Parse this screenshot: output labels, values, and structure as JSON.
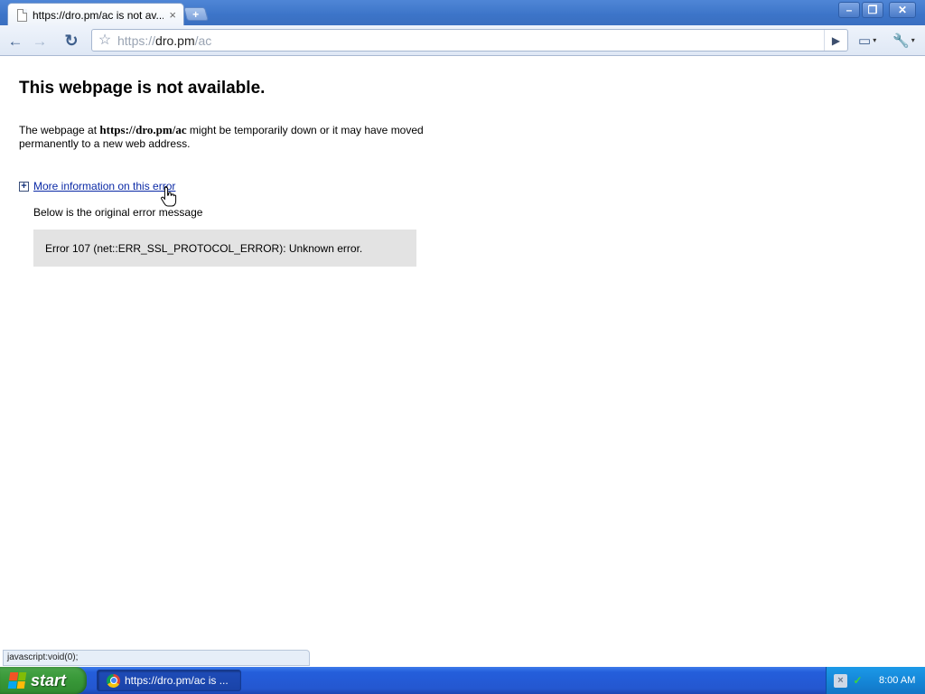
{
  "browser": {
    "tab_title": "https://dro.pm/ac is not av...",
    "tab_close": "×",
    "new_tab": "+",
    "window_controls": {
      "minimize": "–",
      "maximize": "❐",
      "close": "✕"
    },
    "nav": {
      "back": "←",
      "forward": "→",
      "reload": "↻"
    },
    "omnibox": {
      "star": "☆",
      "scheme": "https://",
      "host": "dro.pm",
      "path": "/ac",
      "go": "▶"
    },
    "page_menu": "▭",
    "wrench_menu": "🔧",
    "caret": "▾"
  },
  "page": {
    "title": "This webpage is not available.",
    "desc_prefix": "The webpage at ",
    "desc_url": "https://dro.pm/ac",
    "desc_suffix": " might be temporarily down or it may have moved permanently to a new web address.",
    "more_info_toggle": "+",
    "more_info_link": "More information on this error",
    "below_message": "Below is the original error message",
    "error_message": "Error 107 (net::ERR_SSL_PROTOCOL_ERROR): Unknown error."
  },
  "status_bar": {
    "text": "javascript:void(0);"
  },
  "taskbar": {
    "start_label": "start",
    "task_label": "https://dro.pm/ac is ...",
    "tray_net": "×",
    "tray_security": "✓",
    "clock": "8:00 AM"
  },
  "colors": {
    "link": "#0b2aa6",
    "error_box_bg": "#e3e3e3",
    "taskbar_blue": "#245edb",
    "start_green": "#3a9a3a"
  }
}
